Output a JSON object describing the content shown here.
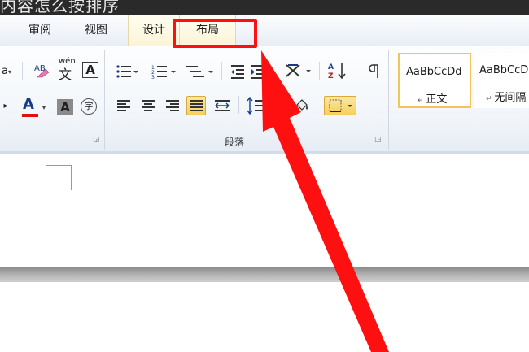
{
  "title": {
    "text": "内容怎么按排序"
  },
  "tabs": [
    {
      "label": "审阅"
    },
    {
      "label": "视图"
    },
    {
      "label": "设计"
    },
    {
      "label": "布局"
    }
  ],
  "ribbon": {
    "font_group": {
      "font_size_fragment": "a",
      "phonetic_guide_label": "wén",
      "font_color": "#e01010"
    },
    "paragraph_group": {
      "label": "段落"
    },
    "styles_gallery": {
      "items": [
        {
          "sample": "AaBbCcDd",
          "name": "正文"
        },
        {
          "sample": "AaBbCcD",
          "name": "无间隔"
        }
      ]
    }
  },
  "annotation": {
    "color": "#ff1010"
  }
}
